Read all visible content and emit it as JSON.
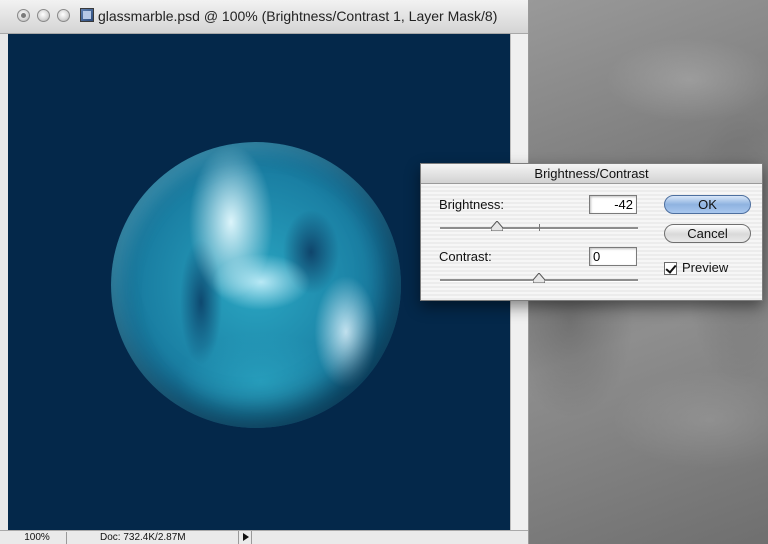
{
  "document": {
    "title": "glassmarble.psd @ 100% (Brightness/Contrast 1, Layer Mask/8)",
    "status": {
      "zoom": "100%",
      "doc_info": "Doc: 732.4K/2.87M"
    }
  },
  "dialog": {
    "title": "Brightness/Contrast",
    "brightness_label": "Brightness:",
    "brightness_value": "-42",
    "brightness_level": -42,
    "contrast_label": "Contrast:",
    "contrast_value": "0",
    "contrast_level": 0,
    "ok_label": "OK",
    "cancel_label": "Cancel",
    "preview_label": "Preview",
    "preview_checked": true
  },
  "colors": {
    "canvas_background": "#04284a",
    "ok_button": "#8fb3e0"
  },
  "icons": {
    "close": "close-icon",
    "minimize": "minimize-icon",
    "zoom": "zoom-icon",
    "document": "psd-document-icon",
    "status_menu": "triangle-right-icon",
    "slider_thumb": "triangle-up-icon"
  }
}
